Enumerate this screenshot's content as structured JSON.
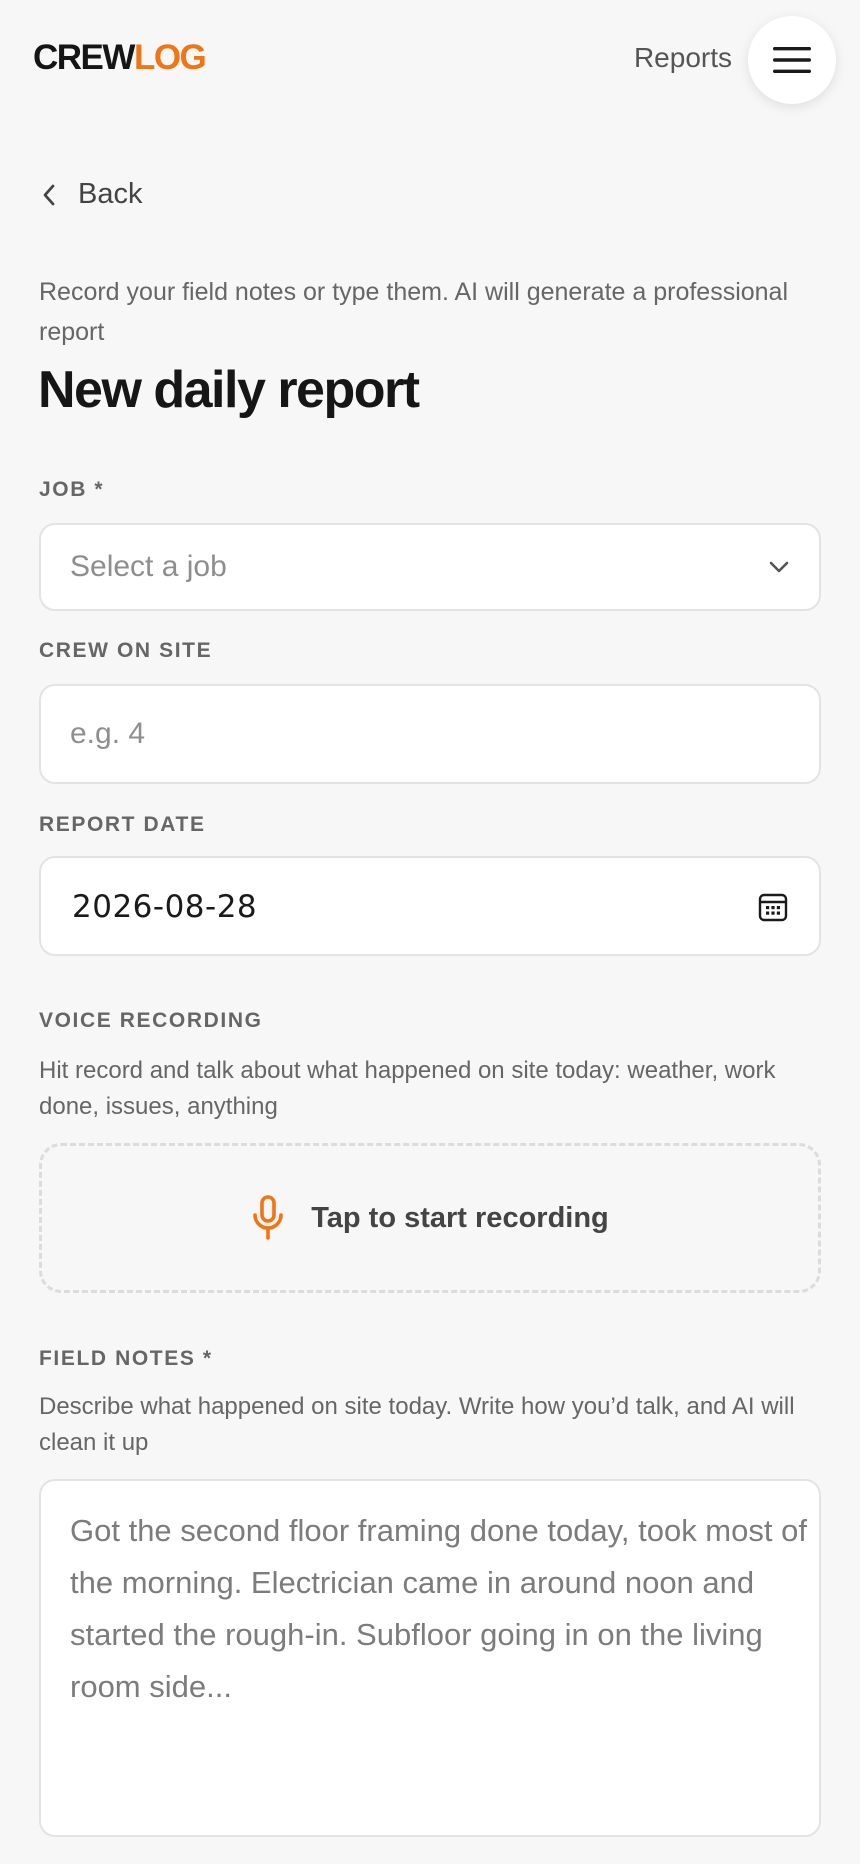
{
  "header": {
    "logo_part1": "CREW",
    "logo_part2": "LOG",
    "nav_reports": "Reports",
    "brand_color": "#f07515"
  },
  "back_label": "Back",
  "intro": "Record your field notes or type them. AI will generate a professional report",
  "title": "New daily report",
  "job": {
    "label": "JOB *",
    "placeholder": "Select a job"
  },
  "crew": {
    "label": "CREW ON SITE",
    "placeholder": "e.g. 4"
  },
  "date": {
    "label": "REPORT DATE",
    "value": "2026-08-28"
  },
  "voice": {
    "label": "VOICE RECORDING",
    "help": "Hit record and talk about what happened on site today: weather, work done, issues, anything",
    "button_label": "Tap to start recording"
  },
  "notes": {
    "label": "FIELD NOTES *",
    "help": "Describe what happened on site today. Write how you’d talk, and AI will clean it up",
    "placeholder": "Got the second floor framing done today, took most of the morning. Electrician came in around noon and started the rough-in. Subfloor going in on the living room side..."
  },
  "icons": {
    "menu": "hamburger-menu-icon",
    "back": "chevron-left-icon",
    "select": "chevron-down-icon",
    "calendar": "calendar-icon",
    "mic": "microphone-icon"
  }
}
